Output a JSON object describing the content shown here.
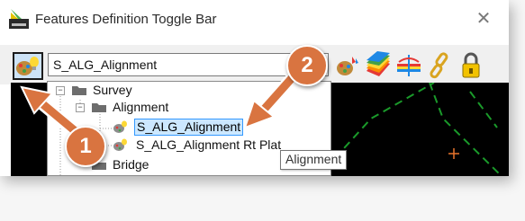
{
  "window": {
    "title": "Features Definition Toggle Bar",
    "close_glyph": "✕"
  },
  "toolbar": {
    "active_feature_value": "S_ALG_Alignment",
    "tools": [
      {
        "name": "feature-palette-icon"
      },
      {
        "name": "surface-rainbow-icon"
      },
      {
        "name": "linear-template-icon"
      },
      {
        "name": "link-icon"
      },
      {
        "name": "lock-icon"
      }
    ]
  },
  "tree": {
    "items": [
      {
        "label": "Survey",
        "expander": "−"
      },
      {
        "label": "Alignment",
        "expander": "−"
      },
      {
        "label": "S_ALG_Alignment",
        "selected": true
      },
      {
        "label": "S_ALG_Alignment Rt Plat"
      },
      {
        "label": "Bridge"
      }
    ],
    "scroll_up_glyph": "^"
  },
  "tooltip": {
    "text": "Alignment"
  },
  "callouts": [
    {
      "number": "1"
    },
    {
      "number": "2"
    }
  ],
  "colors": {
    "callout": "#d97440",
    "selection_fill": "#cce8ff",
    "selection_border": "#3399ff",
    "canvas": "#000000",
    "dashed_lines": "#1a9a2a",
    "cursor_cross": "#e8742c"
  }
}
